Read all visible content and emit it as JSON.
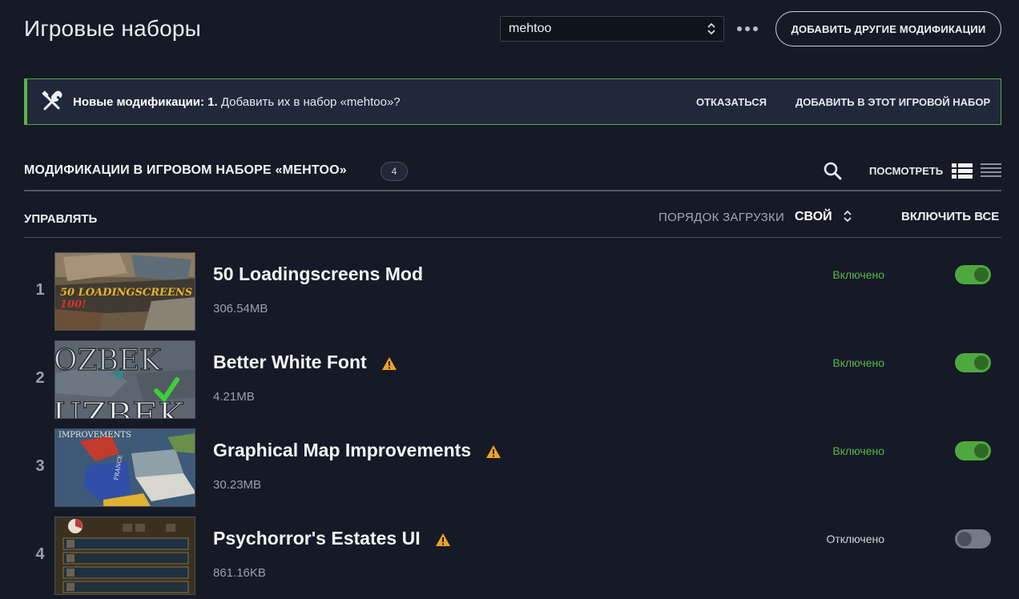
{
  "header": {
    "title": "Игровые наборы",
    "playset_selected": "mehtoo",
    "more_label": "•••",
    "add_mods_label": "ДОБАВИТЬ ДРУГИЕ МОДИФИКАЦИИ"
  },
  "banner": {
    "bold_text": "Новые модификации: 1.",
    "text": " Добавить их в набор «mehtoo»?",
    "decline_label": "ОТКАЗАТЬСЯ",
    "accept_label": "ДОБАВИТЬ В ЭТОТ ИГРОВОЙ НАБОР",
    "accent_color": "#58b646"
  },
  "section": {
    "title": "МОДИФИКАЦИИ В ИГРОВОМ НАБОРЕ «MEHTOO»",
    "count": "4",
    "view_label": "ПОСМОТРЕТЬ"
  },
  "controls": {
    "manage_label": "УПРАВЛЯТЬ",
    "load_order_label": "ПОРЯДОК ЗАГРУЗКИ",
    "load_order_value": "СВОЙ",
    "enable_all_label": "ВКЛЮЧИТЬ ВСЕ"
  },
  "mods": [
    {
      "index": "1",
      "name": "50 Loadingscreens Mod",
      "size": "306.54MB",
      "warning": false,
      "enabled": true,
      "state_label": "Включено",
      "thumb_text": "50 LOADINGSCREENS",
      "thumb_text2": "100!"
    },
    {
      "index": "2",
      "name": "Better White Font",
      "size": "4.21MB",
      "warning": true,
      "enabled": true,
      "state_label": "Включено",
      "thumb_text": "OZBEK",
      "thumb_text2": "UZBEK"
    },
    {
      "index": "3",
      "name": "Graphical Map Improvements",
      "size": "30.23MB",
      "warning": true,
      "enabled": true,
      "state_label": "Включено",
      "thumb_text": "IMPROVEMENTS",
      "thumb_text2": "FRANCE"
    },
    {
      "index": "4",
      "name": "Psychorror's Estates UI",
      "size": "861.16KB",
      "warning": true,
      "enabled": false,
      "state_label": "Отключено",
      "thumb_text": "",
      "thumb_text2": ""
    }
  ],
  "colors": {
    "background": "#151a26",
    "enabled_green": "#58b646",
    "warning_orange": "#f0a21e"
  }
}
